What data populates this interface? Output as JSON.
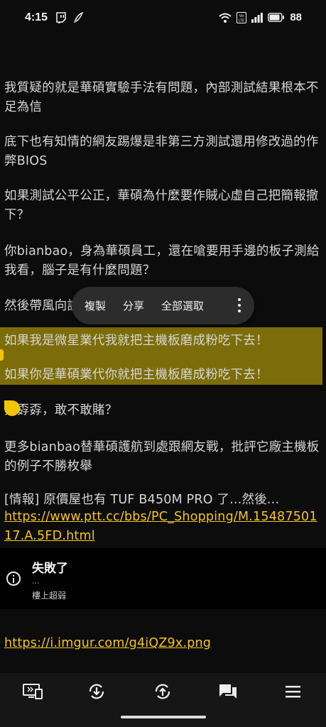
{
  "status_bar": {
    "time": "4:15",
    "battery": "88",
    "icons": [
      "twitch-icon",
      "feather-icon",
      "wifi-icon",
      "volte-icon",
      "signal-icon",
      "battery-icon"
    ]
  },
  "paragraphs": {
    "p1": "我質疑的就是華碩實驗手法有問題，內部測試結果根本不足為信",
    "p2": "底下也有知情的網友踢爆是非第三方測試還用修改過的作弊BIOS",
    "p3": "如果測試公平公正，華碩為什麼要作賊心虛自己把簡報撤下？",
    "p4": "你bianbao，身為華碩員工，還在嗆要用手邊的板子測給我看，腦子是有什麼問題？",
    "p5": "然後帶風向說",
    "p6": "如果我是微星業代我就把主機板磨成粉吃下去！",
    "p7": "如果你是華碩業代你就把主機板磨成粉吃下去！",
    "p8": "孬孬孬，敢不敢賭？",
    "p9": "更多bianbao替華碩護航到處跟網友戰，批評它廠主機板的例子不勝枚舉",
    "p10": "[情報]  原價屋也有 TUF B450M PRO 了...然後...",
    "link1": "https://www.ptt.cc/bbs/PC_Shopping/M.1548750117.A.5FD.html",
    "link2": "https://i.imgur.com/g4iQZ9x.png"
  },
  "context_menu": {
    "copy": "複製",
    "share": "分享",
    "select_all": "全部選取",
    "more_icon": "more-vert-icon"
  },
  "error_card": {
    "title": "失敗了",
    "dots": "...",
    "subtitle": "樓上超弱",
    "icon": "info-icon"
  },
  "bottom_nav": [
    "cast-screen-icon",
    "refresh-down-icon",
    "refresh-up-icon",
    "comments-icon",
    "menu-icon"
  ],
  "colors": {
    "background": "#0c0c0c",
    "link": "#f6c51a",
    "selection": "#7c6d0a",
    "handle": "#f5c400"
  }
}
